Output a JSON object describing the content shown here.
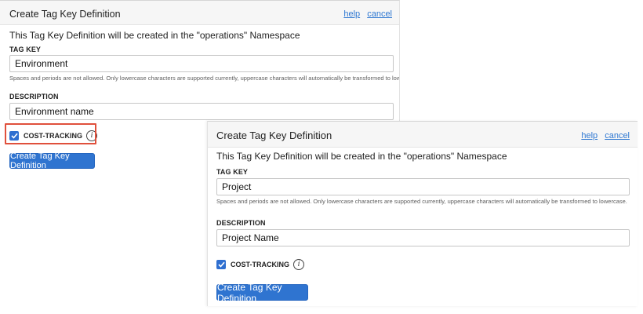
{
  "panel1": {
    "title": "Create Tag Key Definition",
    "help_label": "help",
    "cancel_label": "cancel",
    "namespace_info": "This Tag Key Definition will be created in the \"operations\" Namespace",
    "tag_key_label": "TAG KEY",
    "tag_key_value": "Environment",
    "tag_key_hint": "Spaces and periods are not allowed. Only lowercase characters are supported currently, uppercase characters will automatically be transformed to lowercase.",
    "description_label": "DESCRIPTION",
    "description_value": "Environment name",
    "cost_tracking_label": "COST-TRACKING",
    "cost_tracking_checked": true,
    "info_icon_glyph": "i",
    "create_button": "Create Tag Key Definition"
  },
  "panel2": {
    "title": "Create Tag Key Definition",
    "help_label": "help",
    "cancel_label": "cancel",
    "namespace_info": "This Tag Key Definition will be created in the \"operations\" Namespace",
    "tag_key_label": "TAG KEY",
    "tag_key_value": "Project",
    "tag_key_hint": "Spaces and periods are not allowed. Only lowercase characters are supported currently, uppercase characters will automatically be transformed to lowercase.",
    "description_label": "DESCRIPTION",
    "description_value": "Project Name",
    "cost_tracking_label": "COST-TRACKING",
    "cost_tracking_checked": true,
    "info_icon_glyph": "i",
    "create_button": "Create Tag Key Definition"
  },
  "colors": {
    "accent": "#2f74d0",
    "link": "#2f78d2",
    "highlight": "#e0503c"
  },
  "icons": [
    "checkbox-checked-icon",
    "info-icon"
  ]
}
